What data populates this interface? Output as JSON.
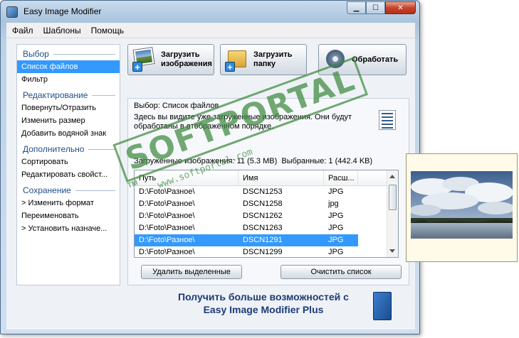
{
  "window": {
    "title": "Easy Image Modifier"
  },
  "caption": {
    "minimize": "▁",
    "maximize": "☐",
    "close": "✕"
  },
  "menu": [
    "Файл",
    "Шаблоны",
    "Помощь"
  ],
  "sidebar": {
    "sections": [
      {
        "title": "Выбор",
        "items": [
          "Список файлов",
          "Фильтр"
        ]
      },
      {
        "title": "Редактирование",
        "items": [
          "Повернуть/Отразить",
          "Изменить размер",
          "Добавить водяной знак"
        ]
      },
      {
        "title": "Дополнительно",
        "items": [
          "Сортировать",
          "Редактировать свойст..."
        ]
      },
      {
        "title": "Сохранение",
        "items": [
          "> Изменить формат",
          "Переименовать",
          "> Установить назначе..."
        ]
      }
    ],
    "selected": "Список файлов"
  },
  "toolbar": {
    "load_images": [
      "Загрузить",
      "изображения"
    ],
    "load_folder": [
      "Загрузить",
      "папку"
    ],
    "process": "Обработать"
  },
  "panel": {
    "title": "Выбор: Список файлов",
    "description": "Здесь вы видите уже загруженные изображения. Они будут обработаны в отображённом порядке.",
    "stats_loaded": "Загруженные изображения: 11 (5.3 MB)",
    "stats_selected": "Выбранные: 1 (442.4 KB)",
    "columns": [
      "Путь",
      "Имя",
      "Расш..."
    ],
    "rows": [
      {
        "path": "D:\\Foto\\Разное\\",
        "name": "DSCN1253",
        "ext": "JPG"
      },
      {
        "path": "D:\\Foto\\Разное\\",
        "name": "DSCN1258",
        "ext": "jpg"
      },
      {
        "path": "D:\\Foto\\Разное\\",
        "name": "DSCN1262",
        "ext": "JPG"
      },
      {
        "path": "D:\\Foto\\Разное\\",
        "name": "DSCN1263",
        "ext": "JPG"
      },
      {
        "path": "D:\\Foto\\Разное\\",
        "name": "DSCN1291",
        "ext": "JPG"
      },
      {
        "path": "D:\\Foto\\Разное\\",
        "name": "DSCN1299",
        "ext": "JPG"
      }
    ],
    "selected_row": 4,
    "delete_selected": "Удалить выделенные",
    "clear_list": "Очистить список"
  },
  "promo": {
    "line1": "Получить больше возможностей с",
    "line2": "Easy Image Modifier Plus"
  },
  "watermark": {
    "brand": "SOFTPORTAL",
    "url": "www.softportal.com",
    "tm": "TM"
  }
}
